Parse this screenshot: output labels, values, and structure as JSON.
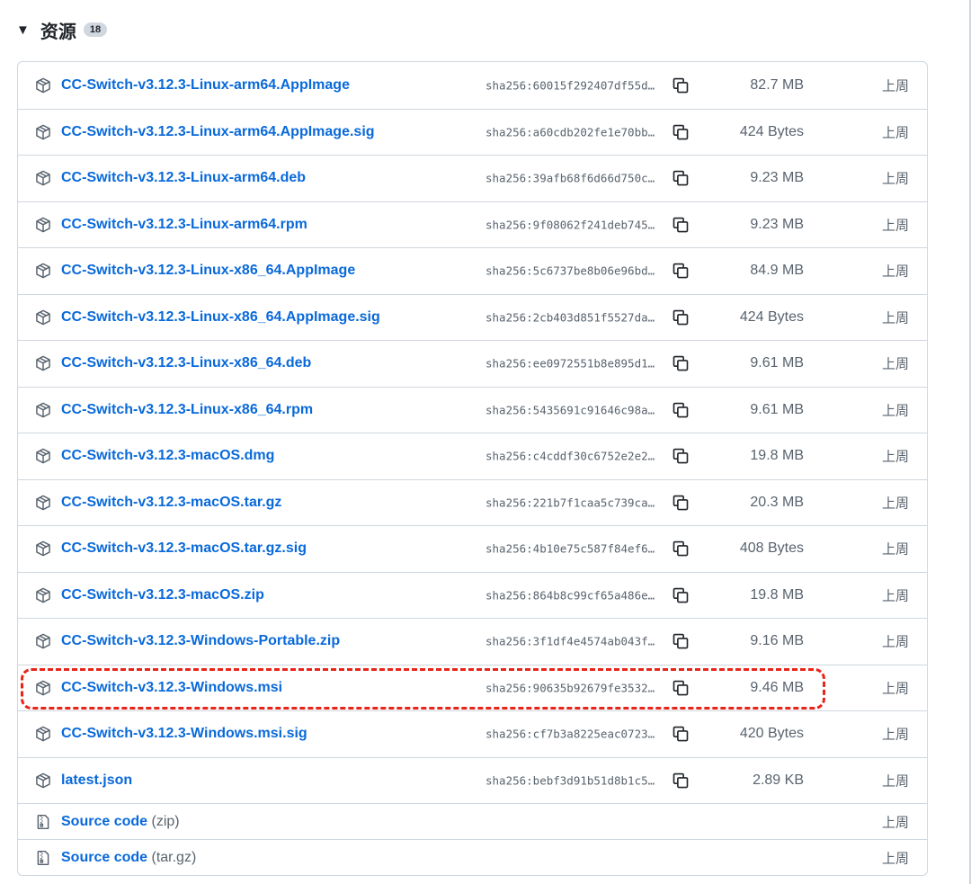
{
  "section": {
    "title": "资源",
    "count": "18",
    "toggle": "▼"
  },
  "assets": [
    {
      "name": "CC-Switch-v3.12.3-Linux-arm64.AppImage",
      "sha": "sha256:60015f292407df55d…",
      "size": "82.7 MB",
      "date": "上周"
    },
    {
      "name": "CC-Switch-v3.12.3-Linux-arm64.AppImage.sig",
      "sha": "sha256:a60cdb202fe1e70bb…",
      "size": "424 Bytes",
      "date": "上周"
    },
    {
      "name": "CC-Switch-v3.12.3-Linux-arm64.deb",
      "sha": "sha256:39afb68f6d66d750c…",
      "size": "9.23 MB",
      "date": "上周"
    },
    {
      "name": "CC-Switch-v3.12.3-Linux-arm64.rpm",
      "sha": "sha256:9f08062f241deb745…",
      "size": "9.23 MB",
      "date": "上周"
    },
    {
      "name": "CC-Switch-v3.12.3-Linux-x86_64.AppImage",
      "sha": "sha256:5c6737be8b06e96bd…",
      "size": "84.9 MB",
      "date": "上周"
    },
    {
      "name": "CC-Switch-v3.12.3-Linux-x86_64.AppImage.sig",
      "sha": "sha256:2cb403d851f5527da…",
      "size": "424 Bytes",
      "date": "上周"
    },
    {
      "name": "CC-Switch-v3.12.3-Linux-x86_64.deb",
      "sha": "sha256:ee0972551b8e895d1…",
      "size": "9.61 MB",
      "date": "上周"
    },
    {
      "name": "CC-Switch-v3.12.3-Linux-x86_64.rpm",
      "sha": "sha256:5435691c91646c98a…",
      "size": "9.61 MB",
      "date": "上周"
    },
    {
      "name": "CC-Switch-v3.12.3-macOS.dmg",
      "sha": "sha256:c4cddf30c6752e2e2…",
      "size": "19.8 MB",
      "date": "上周"
    },
    {
      "name": "CC-Switch-v3.12.3-macOS.tar.gz",
      "sha": "sha256:221b7f1caa5c739ca…",
      "size": "20.3 MB",
      "date": "上周"
    },
    {
      "name": "CC-Switch-v3.12.3-macOS.tar.gz.sig",
      "sha": "sha256:4b10e75c587f84ef6…",
      "size": "408 Bytes",
      "date": "上周"
    },
    {
      "name": "CC-Switch-v3.12.3-macOS.zip",
      "sha": "sha256:864b8c99cf65a486e…",
      "size": "19.8 MB",
      "date": "上周"
    },
    {
      "name": "CC-Switch-v3.12.3-Windows-Portable.zip",
      "sha": "sha256:3f1df4e4574ab043f…",
      "size": "9.16 MB",
      "date": "上周"
    },
    {
      "name": "CC-Switch-v3.12.3-Windows.msi",
      "sha": "sha256:90635b92679fe3532…",
      "size": "9.46 MB",
      "date": "上周"
    },
    {
      "name": "CC-Switch-v3.12.3-Windows.msi.sig",
      "sha": "sha256:cf7b3a8225eac0723…",
      "size": "420 Bytes",
      "date": "上周"
    },
    {
      "name": "latest.json",
      "sha": "sha256:bebf3d91b51d8b1c5…",
      "size": "2.89 KB",
      "date": "上周"
    }
  ],
  "source_code": [
    {
      "label": "Source code",
      "format": "(zip)",
      "date": "上周"
    },
    {
      "label": "Source code",
      "format": "(tar.gz)",
      "date": "上周"
    }
  ],
  "colors": {
    "link": "#0969da",
    "muted": "#59636e",
    "border": "#d0d7de",
    "highlight": "#e8241a"
  },
  "icons": {
    "asset": "package-icon",
    "copy": "copy-icon",
    "source": "file-zip-icon"
  }
}
